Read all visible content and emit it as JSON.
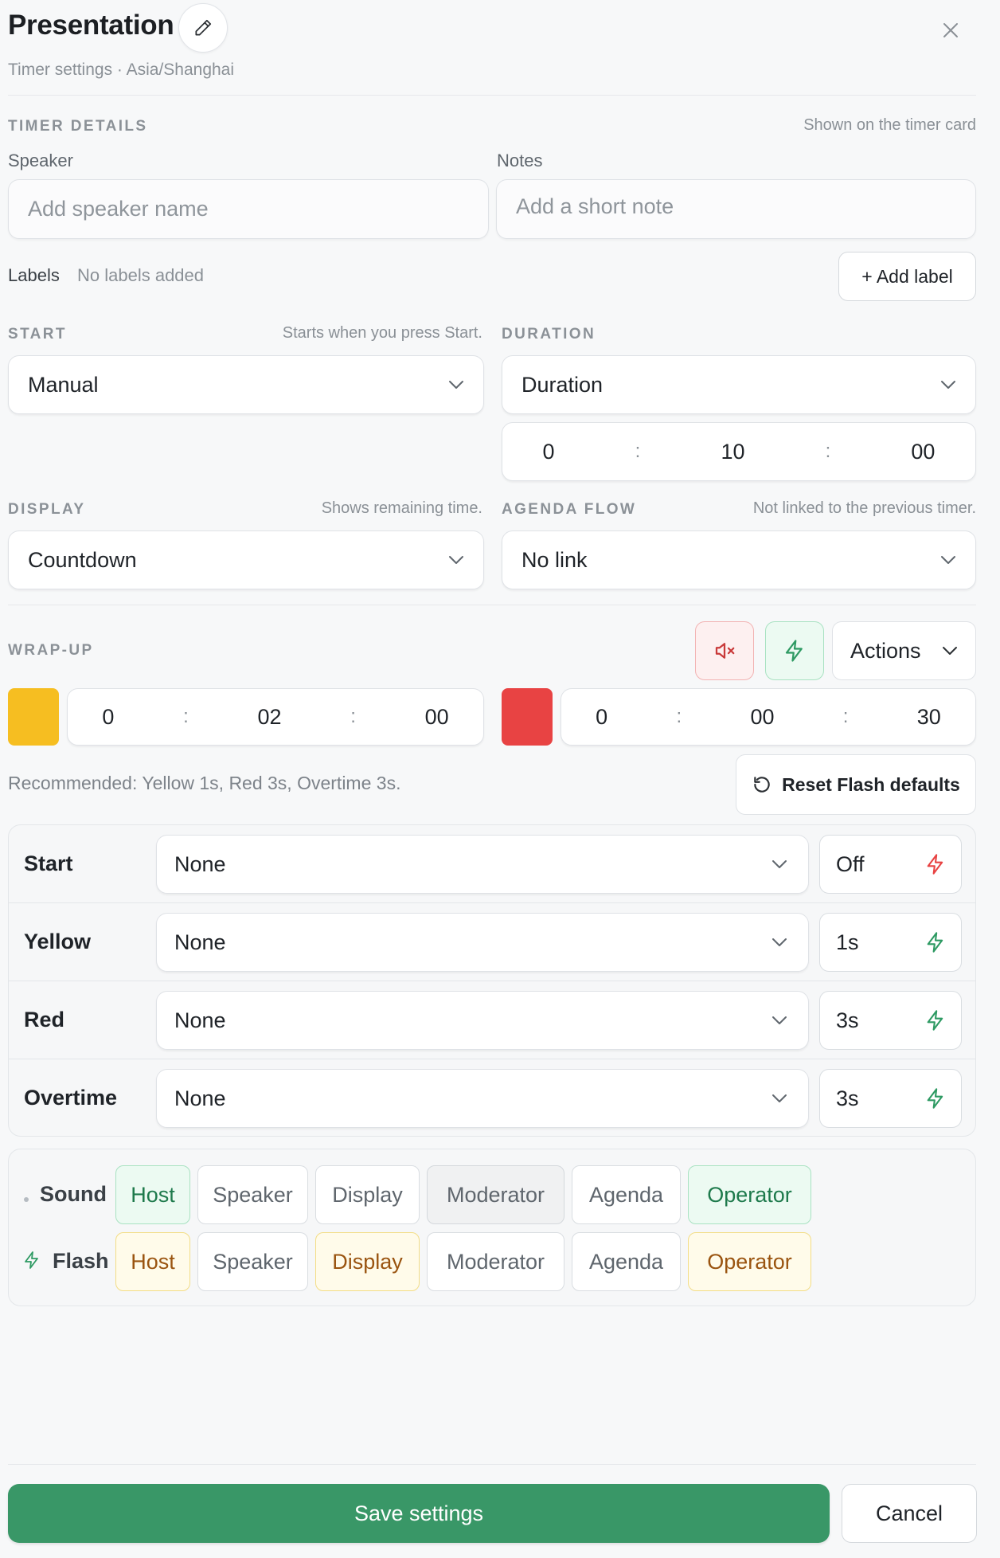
{
  "header": {
    "title": "Presentation",
    "subtitle": "Timer settings · Asia/Shanghai"
  },
  "timer_details": {
    "section_label": "TIMER DETAILS",
    "hint": "Shown on the timer card",
    "speaker_label": "Speaker",
    "speaker_placeholder": "Add speaker name",
    "notes_label": "Notes",
    "notes_placeholder": "Add a short note",
    "labels_label": "Labels",
    "labels_value": "No labels added",
    "add_label_button": "+ Add label"
  },
  "start": {
    "section_label": "START",
    "hint": "Starts when you press Start.",
    "selected": "Manual"
  },
  "duration": {
    "section_label": "DURATION",
    "selected": "Duration",
    "hours": "0",
    "minutes": "10",
    "seconds": "00"
  },
  "display": {
    "section_label": "DISPLAY",
    "hint": "Shows remaining time.",
    "selected": "Countdown"
  },
  "agenda_flow": {
    "section_label": "AGENDA FLOW",
    "hint": "Not linked to the previous timer.",
    "selected": "No link"
  },
  "wrap_up": {
    "section_label": "WRAP-UP",
    "actions_label": "Actions",
    "yellow": {
      "color": "#F6BE21",
      "hours": "0",
      "minutes": "02",
      "seconds": "00"
    },
    "red": {
      "color": "#E84343",
      "hours": "0",
      "minutes": "00",
      "seconds": "30"
    },
    "recommendation": "Recommended: Yellow 1s, Red 3s, Overtime 3s.",
    "reset_button": "Reset Flash defaults"
  },
  "triggers": [
    {
      "label": "Start",
      "sound": "None",
      "flash": "Off",
      "flash_color": "#E84343"
    },
    {
      "label": "Yellow",
      "sound": "None",
      "flash": "1s",
      "flash_color": "#2E9A63"
    },
    {
      "label": "Red",
      "sound": "None",
      "flash": "3s",
      "flash_color": "#2E9A63"
    },
    {
      "label": "Overtime",
      "sound": "None",
      "flash": "3s",
      "flash_color": "#2E9A63"
    }
  ],
  "targets": {
    "sound_label": "Sound",
    "flash_label": "Flash",
    "options": [
      "Host",
      "Speaker",
      "Display",
      "Moderator",
      "Agenda",
      "Operator"
    ]
  },
  "footer": {
    "save_button": "Save settings",
    "cancel_button": "Cancel"
  },
  "colors": {
    "accent_green": "#399767",
    "muted_red": "#C93A3A",
    "yellow_swatch": "#F6BE21",
    "red_swatch": "#E84343"
  }
}
